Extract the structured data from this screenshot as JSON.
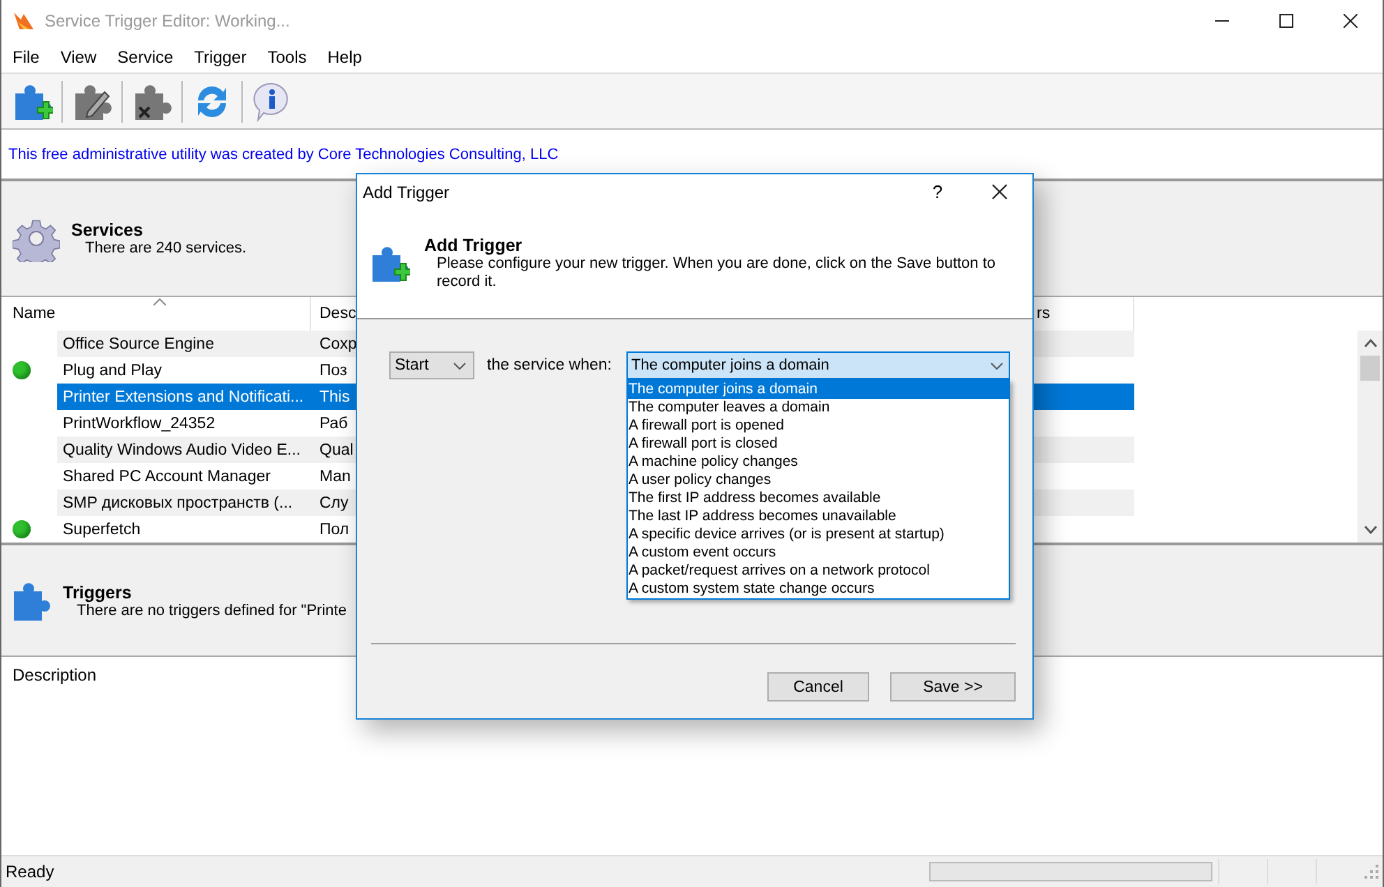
{
  "window": {
    "title": "Service Trigger Editor: Working..."
  },
  "menu": [
    "File",
    "View",
    "Service",
    "Trigger",
    "Tools",
    "Help"
  ],
  "banner": "This free administrative utility was created by Core Technologies Consulting, LLC",
  "services_panel": {
    "title": "Services",
    "subtitle": "There are 240 services."
  },
  "table": {
    "columns": [
      "Name",
      "Desc",
      "rs"
    ],
    "rows": [
      {
        "name": "Office  Source Engine",
        "description": "Сохр",
        "running": false,
        "selected": false
      },
      {
        "name": "Plug and Play",
        "description": "Поз",
        "running": true,
        "selected": false
      },
      {
        "name": "Printer Extensions and Notificati...",
        "description": "This",
        "running": false,
        "selected": true
      },
      {
        "name": "PrintWorkflow_24352",
        "description": "Раб",
        "running": false,
        "selected": false
      },
      {
        "name": "Quality Windows Audio Video E...",
        "description": "Qual",
        "running": false,
        "selected": false
      },
      {
        "name": "Shared PC Account Manager",
        "description": "Man",
        "running": false,
        "selected": false
      },
      {
        "name": "SMP дисковых пространств (...",
        "description": "Слу",
        "running": false,
        "selected": false
      },
      {
        "name": "Superfetch",
        "description": "Пол",
        "running": true,
        "selected": false
      }
    ]
  },
  "triggers_panel": {
    "title": "Triggers",
    "subtitle": "There are no triggers defined for \"Printe"
  },
  "description_label": "Description",
  "status_bar": {
    "text": "Ready"
  },
  "dialog": {
    "title": "Add Trigger",
    "help": "?",
    "header_title": "Add Trigger",
    "header_text": "Please configure your new trigger. When you are done, click on the Save button to record it.",
    "action": "Start",
    "label": "the service when:",
    "condition": "The computer joins a domain",
    "options": [
      {
        "label": "The computer joins a domain",
        "selected": true
      },
      {
        "label": "The computer leaves a domain",
        "selected": false
      },
      {
        "label": "A firewall port is opened",
        "selected": false
      },
      {
        "label": "A firewall port is closed",
        "selected": false
      },
      {
        "label": "A machine policy changes",
        "selected": false
      },
      {
        "label": "A user policy changes",
        "selected": false
      },
      {
        "label": "The first IP address becomes available",
        "selected": false
      },
      {
        "label": "The last IP address becomes unavailable",
        "selected": false
      },
      {
        "label": "A specific device arrives (or is present at startup)",
        "selected": false
      },
      {
        "label": "A custom event occurs",
        "selected": false
      },
      {
        "label": "A packet/request arrives on a network protocol",
        "selected": false
      },
      {
        "label": "A custom system state change occurs",
        "selected": false
      }
    ],
    "buttons": [
      "Cancel",
      "Save >>"
    ]
  }
}
